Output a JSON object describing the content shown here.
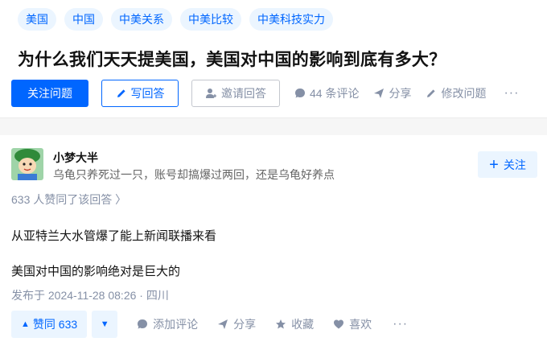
{
  "tags": [
    "美国",
    "中国",
    "中美关系",
    "中美比较",
    "中美科技实力"
  ],
  "question": {
    "title": "为什么我们天天提美国，美国对中国的影响到底有多大？"
  },
  "actions": {
    "follow_question": "关注问题",
    "write_answer": "写回答",
    "invite_answer": "邀请回答",
    "comments": "44 条评论",
    "share": "分享",
    "edit_question": "修改问题",
    "more": "···"
  },
  "answer": {
    "author": {
      "name": "小梦大半",
      "bio": "乌龟只养死过一只，账号却搞爆过两回，还是乌龟好养点"
    },
    "follow_label": "关注",
    "vote_summary": "633 人赞同了该回答 〉",
    "paragraphs": [
      "从亚特兰大水管爆了能上新闻联播来看",
      "美国对中国的影响绝对是巨大的"
    ],
    "published": "发布于 2024-11-28 08:26 · 四川",
    "upvote_label": "赞同 633",
    "add_comment": "添加评论",
    "share": "分享",
    "collect": "收藏",
    "like": "喜欢",
    "more": "···"
  },
  "colors": {
    "accent": "#0066ff",
    "accent_bg": "#ebf5ff",
    "muted": "#8590a6"
  }
}
